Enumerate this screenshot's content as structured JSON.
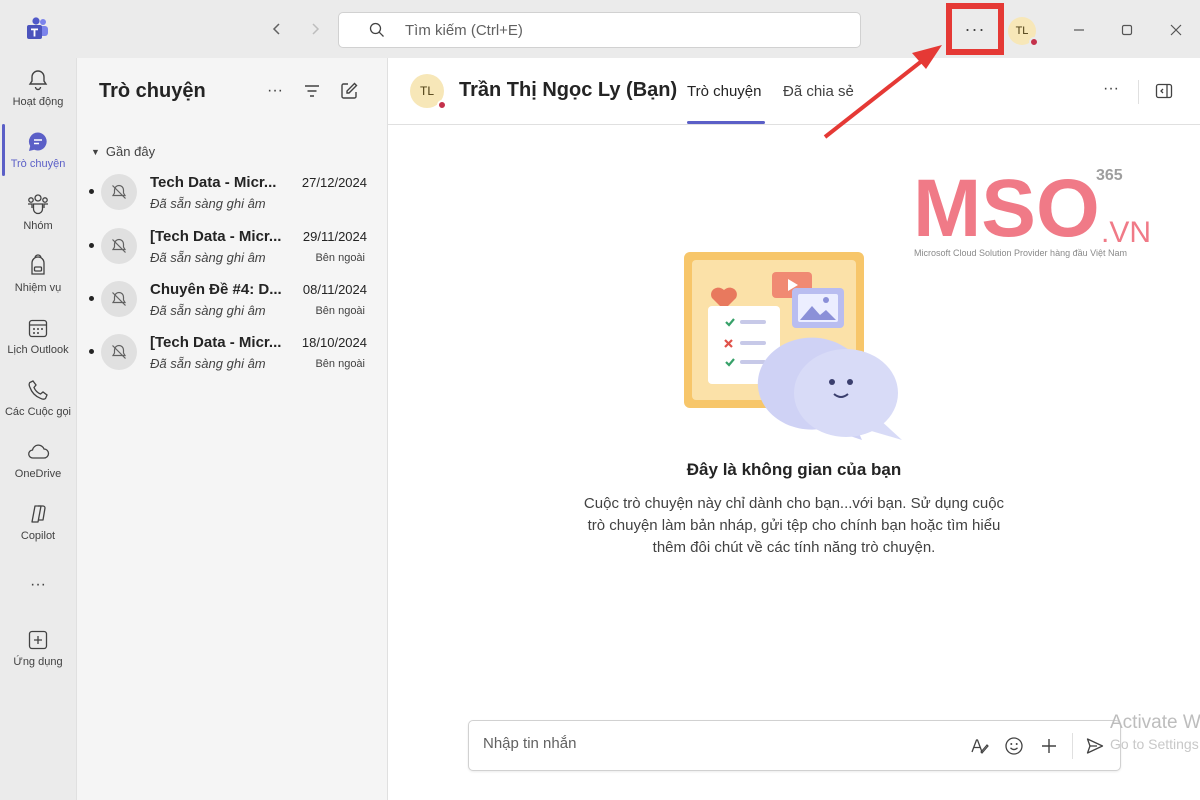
{
  "titlebar": {
    "search_placeholder": "Tìm kiếm (Ctrl+E)",
    "more_label": "···",
    "user_initials": "TL"
  },
  "rail": {
    "items": [
      {
        "label": "Hoạt động",
        "icon": "bell-icon"
      },
      {
        "label": "Trò chuyện",
        "icon": "chat-icon",
        "active": true
      },
      {
        "label": "Nhóm",
        "icon": "teams-icon"
      },
      {
        "label": "Nhiệm vụ",
        "icon": "backpack-icon"
      },
      {
        "label": "Lịch Outlook",
        "icon": "calendar-icon"
      },
      {
        "label": "Các Cuộc gọi",
        "icon": "phone-icon"
      },
      {
        "label": "OneDrive",
        "icon": "cloud-icon"
      },
      {
        "label": "Copilot",
        "icon": "copilot-icon"
      },
      {
        "label": "···",
        "icon": "more-icon"
      },
      {
        "label": "Ứng dụng",
        "icon": "apps-icon"
      }
    ]
  },
  "chatlist": {
    "title": "Trò chuyện",
    "more_label": "···",
    "section": "Gần đây",
    "items": [
      {
        "name": "Tech Data - Micr...",
        "date": "27/12/2024",
        "subtitle": "Đã sẵn sàng ghi âm",
        "tag": ""
      },
      {
        "name": "[Tech Data - Micr...",
        "date": "29/11/2024",
        "subtitle": "Đã sẵn sàng ghi âm",
        "tag": "Bên ngoài"
      },
      {
        "name": "Chuyên Đề #4: D...",
        "date": "08/11/2024",
        "subtitle": "Đã sẵn sàng ghi âm",
        "tag": "Bên ngoài"
      },
      {
        "name": "[Tech Data - Micr...",
        "date": "18/10/2024",
        "subtitle": "Đã sẵn sàng ghi âm",
        "tag": "Bên ngoài"
      }
    ]
  },
  "main": {
    "avatar_initials": "TL",
    "chat_title": "Trần Thị Ngọc Ly (Bạn)",
    "tabs": [
      {
        "label": "Trò chuyện",
        "active": true
      },
      {
        "label": "Đã chia sẻ"
      }
    ],
    "more_label": "···",
    "space_title": "Đây là không gian của bạn",
    "space_desc": "Cuộc trò chuyện này chỉ dành cho bạn...với bạn. Sử dụng cuộc trò chuyện làm bản nháp, gửi tệp cho chính bạn hoặc tìm hiểu thêm đôi chút về các tính năng trò chuyện.",
    "composer_placeholder": "Nhập tin nhắn"
  },
  "watermark": {
    "brand": "MSO",
    "brand_suffix": ".VN",
    "superscript": "365",
    "tagline": "Microsoft Cloud Solution Provider hàng đầu Việt Nam"
  },
  "os": {
    "activate_title": "Activate W",
    "activate_sub": "Go to Settings"
  },
  "colors": {
    "accent": "#5b5fc7",
    "highlight_red": "#e53935",
    "brand_pink": "#f07a87",
    "presence_red": "#c4314b"
  }
}
